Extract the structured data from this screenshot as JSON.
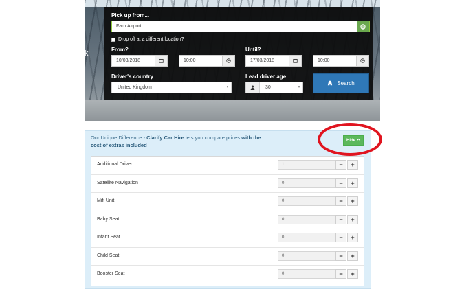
{
  "search_form": {
    "pickup_label": "Pick up from...",
    "pickup_value": "Faro Airport",
    "dropoff_checkbox_label": "Drop off at a different location?",
    "from_label": "From?",
    "from_date": "10/03/2018",
    "from_time": "10:00",
    "until_label": "Until?",
    "until_date": "17/03/2018",
    "until_time": "10:00",
    "country_label": "Driver's country",
    "country_value": "United Kingdom",
    "age_label": "Lead driver age",
    "age_value": "30",
    "search_button": "Search",
    "side_fragment": "k"
  },
  "extras": {
    "intro_prefix": "Our Unique Difference - ",
    "intro_brand": "Clarify Car Hire",
    "intro_middle": " lets you compare prices ",
    "intro_bold": "with the cost of extras included",
    "hide_button": "Hide",
    "items": [
      {
        "name": "Additional Driver",
        "qty": "1"
      },
      {
        "name": "Satellite Navigation",
        "qty": "0"
      },
      {
        "name": "Mifi Unit",
        "qty": "0"
      },
      {
        "name": "Baby Seat",
        "qty": "0"
      },
      {
        "name": "Infant Seat",
        "qty": "0"
      },
      {
        "name": "Child Seat",
        "qty": "0"
      },
      {
        "name": "Booster Seat",
        "qty": "0"
      }
    ],
    "minus": "−",
    "plus": "+"
  },
  "colors": {
    "highlight": "#e0141f",
    "search_button": "#2f78b7",
    "hide_button": "#5cb85c"
  },
  "icons": {
    "location": "globe-icon",
    "calendar": "calendar-icon",
    "clock": "clock-icon",
    "person": "person-icon",
    "road": "road-icon",
    "chevron": "chevron-up-icon"
  }
}
